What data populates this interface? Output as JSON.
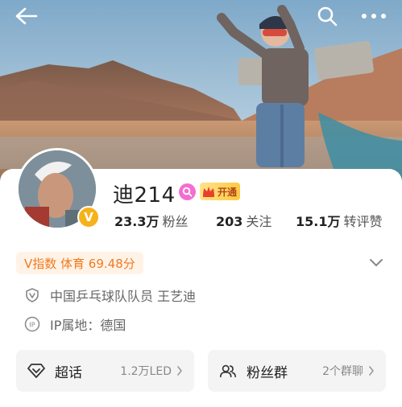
{
  "profile": {
    "name": "迪214",
    "vip_label": "开通",
    "verified_badge": "V"
  },
  "stats": {
    "fans_value": "23.3万",
    "fans_label": "粉丝",
    "following_value": "203",
    "following_label": "关注",
    "engagement_value": "15.1万",
    "engagement_label": "转评赞"
  },
  "vindex": {
    "label": "V指数 体育 69.48分"
  },
  "info": {
    "verification": "中国乒乓球队队员 王艺迪",
    "ip_location": "IP属地：德国"
  },
  "tiles": {
    "supertopic_title": "超话",
    "supertopic_value": "1.2万LED",
    "fangroup_title": "粉丝群",
    "fangroup_value": "2个群聊"
  },
  "icons": {
    "back": "back-arrow-icon",
    "search": "search-icon",
    "more": "more-icon",
    "shield": "shield-icon",
    "ip": "ip-icon",
    "diamond": "diamond-icon",
    "group": "fan-group-icon"
  },
  "colors": {
    "accent_orange": "#f07a1e",
    "vip_gold": "#ffc941",
    "pink_badge": "#f46ed2"
  }
}
